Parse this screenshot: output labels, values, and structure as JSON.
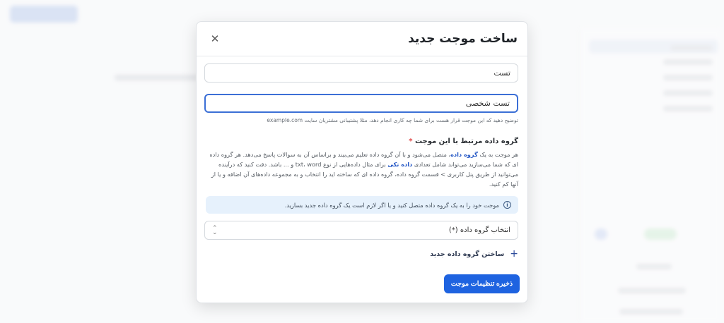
{
  "modal": {
    "title": "ساخت موجت جدید",
    "name_field": {
      "value": "تست"
    },
    "description_field": {
      "value": "تست شخصی",
      "help": "توضیح دهید که این موجت قرار هست برای شما چه کاری انجام دهد، مثلا پشتیبانی مشتریان سایت example.com"
    },
    "dataset_section": {
      "title": "گروه داده مرتبط با این موجت",
      "required_mark": "*",
      "desc_1": "هر موجت به یک ",
      "desc_bold_1": "گروه داده",
      "desc_2": "، متصل می‌شود و با آن گروه داده تعلیم می‌بیند و براساس آن به سوالات پاسخ می‌دهد. هر گروه داده ای که شما می‌سازید می‌تواند شامل تعدادی ",
      "desc_bold_2": "داده تکی",
      "desc_3": " برای مثال داده‌هایی از نوع txt، word و ... باشد. دقت کنید که در‌آینده می‌توانید از طریق پنل کاربری > قسمت گروه داده، گروه داده ای که ساخته اید را انتخاب و به مجموعه داده‌های آن اضافه و یا از آنها کم کنید."
    },
    "info_text": "موجت خود را به یک گروه داده متصل کنید و یا اگر لازم است یک گروه داده جدید بسازید.",
    "select_value": "انتخاب گروه داده (*)",
    "create_dataset_label": "ساختن گروه داده جدید",
    "save_label": "ذخیره تنظیمات موجت"
  },
  "colors": {
    "primary": "#1e63e0",
    "info_bg": "#e6f1fc",
    "required": "#e04545"
  },
  "icons": {
    "close": "close-icon",
    "info": "info-icon",
    "plus": "plus-icon",
    "select_arrows": "chevron-up-down-icon"
  }
}
